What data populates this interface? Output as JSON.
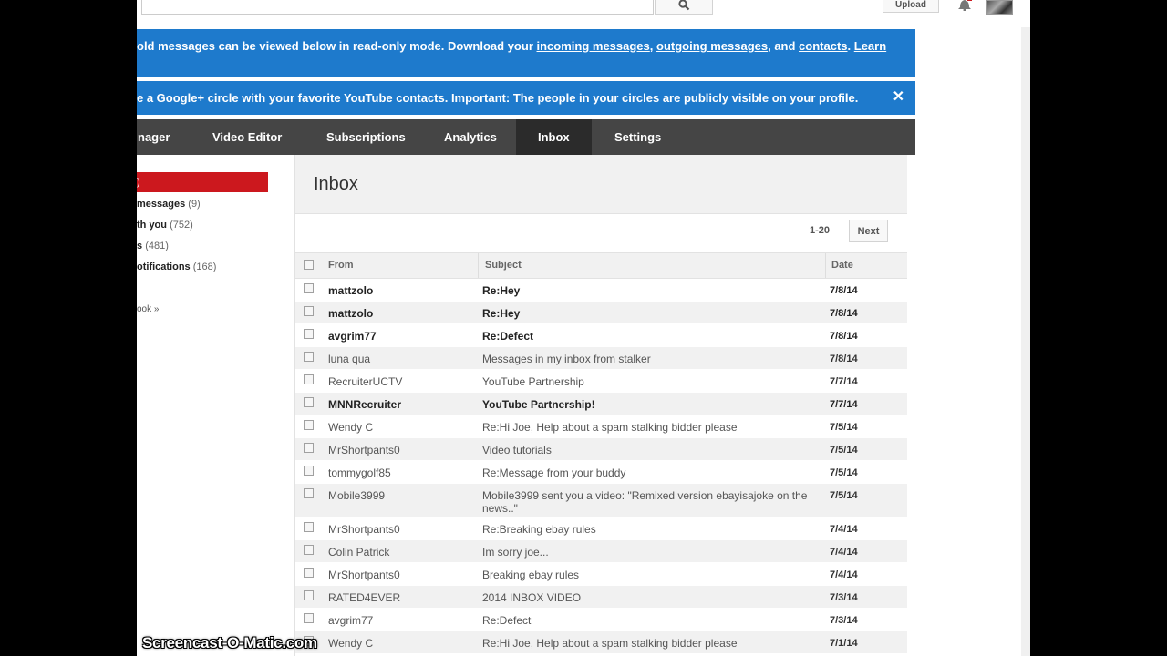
{
  "masthead": {
    "upload_label": "Upload"
  },
  "banners": {
    "old_messages": {
      "text_start": "old messages can be viewed below in read-only mode. Download your ",
      "link_incoming": "incoming messages",
      "sep1": ", ",
      "link_outgoing": "outgoing messages",
      "sep2": ", and ",
      "link_contacts": "contacts",
      "sep3": ". ",
      "link_learn": "Learn"
    },
    "circle": {
      "text": "e a Google+ circle with your favorite YouTube contacts. Important: The people in your circles are publicly visible on your profile.",
      "close_glyph": "✕"
    }
  },
  "tabs": [
    {
      "label": "nager",
      "active": false
    },
    {
      "label": "Video Editor",
      "active": false
    },
    {
      "label": "Subscriptions",
      "active": false
    },
    {
      "label": "Analytics",
      "active": false
    },
    {
      "label": "Inbox",
      "active": true
    },
    {
      "label": "Settings",
      "active": false
    }
  ],
  "left_nav": {
    "inbox_label": ")",
    "items": [
      {
        "label": "messages",
        "count": "(9)"
      },
      {
        "label": "th you",
        "count": "(752)"
      },
      {
        "label": "s",
        "count": "(481)"
      },
      {
        "label": "otifications",
        "count": "(168)"
      },
      {
        "label": "ook »",
        "count": ""
      }
    ]
  },
  "inbox": {
    "title": "Inbox",
    "pager_range": "1-20",
    "next_label": "Next",
    "columns": {
      "from": "From",
      "subject": "Subject",
      "date": "Date"
    },
    "rows": [
      {
        "from": "mattzolo",
        "subject": "Re:Hey",
        "date": "7/8/14",
        "unread": true
      },
      {
        "from": "mattzolo",
        "subject": "Re:Hey",
        "date": "7/8/14",
        "unread": true
      },
      {
        "from": "avgrim77",
        "subject": "Re:Defect",
        "date": "7/8/14",
        "unread": true
      },
      {
        "from": "luna qua",
        "subject": "Messages in my inbox from stalker",
        "date": "7/8/14",
        "unread": false
      },
      {
        "from": "RecruiterUCTV",
        "subject": "YouTube Partnership",
        "date": "7/7/14",
        "unread": false
      },
      {
        "from": "MNNRecruiter",
        "subject": "YouTube Partnership!",
        "date": "7/7/14",
        "unread": true
      },
      {
        "from": "Wendy C",
        "subject": "Re:Hi Joe, Help about a spam stalking bidder please",
        "date": "7/5/14",
        "unread": false
      },
      {
        "from": "MrShortpants0",
        "subject": "Video tutorials",
        "date": "7/5/14",
        "unread": false
      },
      {
        "from": "tommygolf85",
        "subject": "Re:Message from your buddy",
        "date": "7/5/14",
        "unread": false
      },
      {
        "from": "Mobile3999",
        "subject": "Mobile3999 sent you a video: \"Remixed version ebayisajoke on the news..\"",
        "date": "7/5/14",
        "unread": false,
        "tall": true
      },
      {
        "from": "MrShortpants0",
        "subject": "Re:Breaking ebay rules",
        "date": "7/4/14",
        "unread": false
      },
      {
        "from": "Colin Patrick",
        "subject": "Im sorry joe...",
        "date": "7/4/14",
        "unread": false
      },
      {
        "from": "MrShortpants0",
        "subject": "Breaking ebay rules",
        "date": "7/4/14",
        "unread": false
      },
      {
        "from": "RATED4EVER",
        "subject": "2014 INBOX VIDEO",
        "date": "7/3/14",
        "unread": false
      },
      {
        "from": "avgrim77",
        "subject": "Re:Defect",
        "date": "7/3/14",
        "unread": false
      },
      {
        "from": "Wendy C",
        "subject": "Re:Hi Joe, Help about a spam stalking bidder please",
        "date": "7/1/14",
        "unread": false
      }
    ]
  },
  "watermark": "Screencast-O-Matic.com",
  "colors": {
    "banner": "#1e7acc",
    "tabbar": "#454545",
    "tab_active": "#2b2b2b",
    "nav_active": "#cc181e"
  },
  "icons": {
    "search": "search-icon",
    "bell": "bell-icon",
    "close": "close-icon"
  }
}
